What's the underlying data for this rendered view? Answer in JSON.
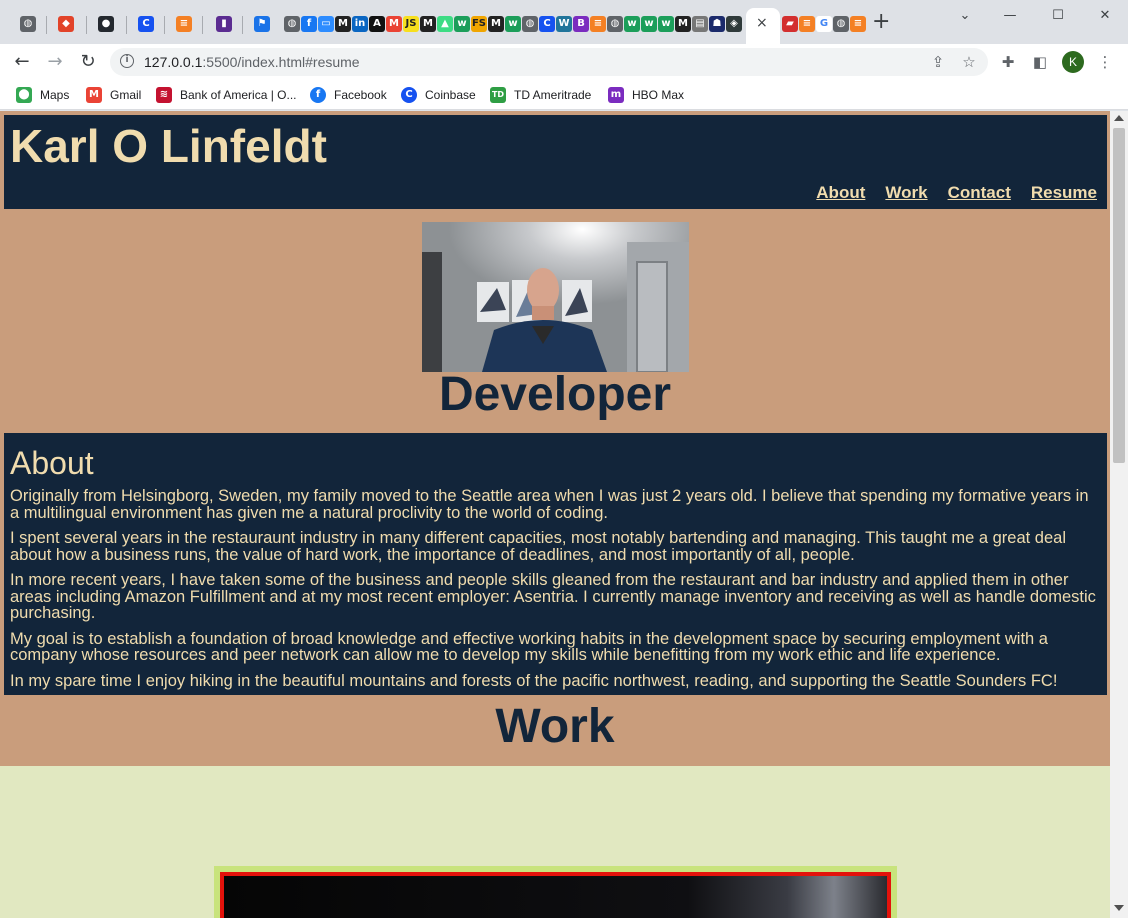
{
  "browser": {
    "active_tab_close": "×",
    "new_tab": "+",
    "window_controls": {
      "minimize": "—",
      "maximize": "☐",
      "close": "✕",
      "menu": "⌄"
    },
    "tab_icons": [
      {
        "name": "globe-icon",
        "color": "#5f6368",
        "glyph": "◍"
      },
      {
        "name": "gitlab-icon",
        "color": "#e24329",
        "glyph": "◆"
      },
      {
        "name": "github-icon",
        "color": "#24292f",
        "glyph": "●"
      },
      {
        "name": "coinbase-icon",
        "color": "#1652f0",
        "glyph": "C"
      },
      {
        "name": "stackoverflow-icon",
        "color": "#f48024",
        "glyph": "≡"
      },
      {
        "name": "app-icon",
        "color": "#5b2c91",
        "glyph": "▮"
      },
      {
        "name": "flag-icon",
        "color": "#1a73e8",
        "glyph": "⚑"
      }
    ],
    "nav": {
      "back": "←",
      "forward": "→",
      "reload": "↻"
    },
    "address": {
      "host": "127.0.0.1",
      "rest": ":5500/index.html#resume"
    },
    "toolbar_icons": {
      "share": "⇪",
      "star": "☆",
      "extensions": "✚",
      "sidepanel": "◧",
      "menu": "⋮"
    },
    "profile_initial": "K",
    "bookmarks": [
      {
        "label": "Maps",
        "icon": "maps-icon",
        "color": "#34a853",
        "glyph": "⬤"
      },
      {
        "label": "Gmail",
        "icon": "gmail-icon",
        "color": "#ea4335",
        "glyph": "M"
      },
      {
        "label": "Bank of America | O...",
        "icon": "bofa-icon",
        "color": "#c41230",
        "glyph": "≋"
      },
      {
        "label": "Facebook",
        "icon": "facebook-icon",
        "color": "#1877f2",
        "glyph": "f"
      },
      {
        "label": "Coinbase",
        "icon": "coinbase-icon",
        "color": "#1652f0",
        "glyph": "C"
      },
      {
        "label": "TD Ameritrade",
        "icon": "td-icon",
        "color": "#2f9e44",
        "glyph": "TD"
      },
      {
        "label": "HBO Max",
        "icon": "hbomax-icon",
        "color": "#7b2cbf",
        "glyph": "m"
      }
    ]
  },
  "site": {
    "title": "Karl O Linfeldt",
    "nav": [
      "About",
      "Work",
      "Contact",
      "Resume"
    ],
    "headline": "Developer",
    "about": {
      "heading": "About",
      "paragraphs": [
        "Originally from Helsingborg, Sweden, my family moved to the Seattle area when I was just 2 years old. I believe that spending my formative years in a multilingual environment has given me a natural proclivity to the world of coding.",
        "I spent several years in the restauraunt industry in many different capacities, most notably bartending and managing. This taught me a great deal about how a business runs, the value of hard work, the importance of deadlines, and most importantly of all, people.",
        "In more recent years, I have taken some of the business and people skills gleaned from the restaurant and bar industry and applied them in other areas including Amazon Fulfillment and at my most recent employer: Asentria. I currently manage inventory and receiving as well as handle domestic purchasing.",
        "My goal is to establish a foundation of broad knowledge and effective working habits in the development space by securing employment with a company whose resources and peer network can allow me to develop my skills while benefitting from my work ethic and life experience.",
        "In my spare time I enjoy hiking in the beautiful mountains and forests of the pacific northwest, reading, and supporting the Seattle Sounders FC!"
      ]
    },
    "work_heading": "Work"
  },
  "colors": {
    "navy": "#12253a",
    "cream": "#f0dcae",
    "tan": "#c99d7c",
    "work_bg": "#e1e8c1"
  }
}
